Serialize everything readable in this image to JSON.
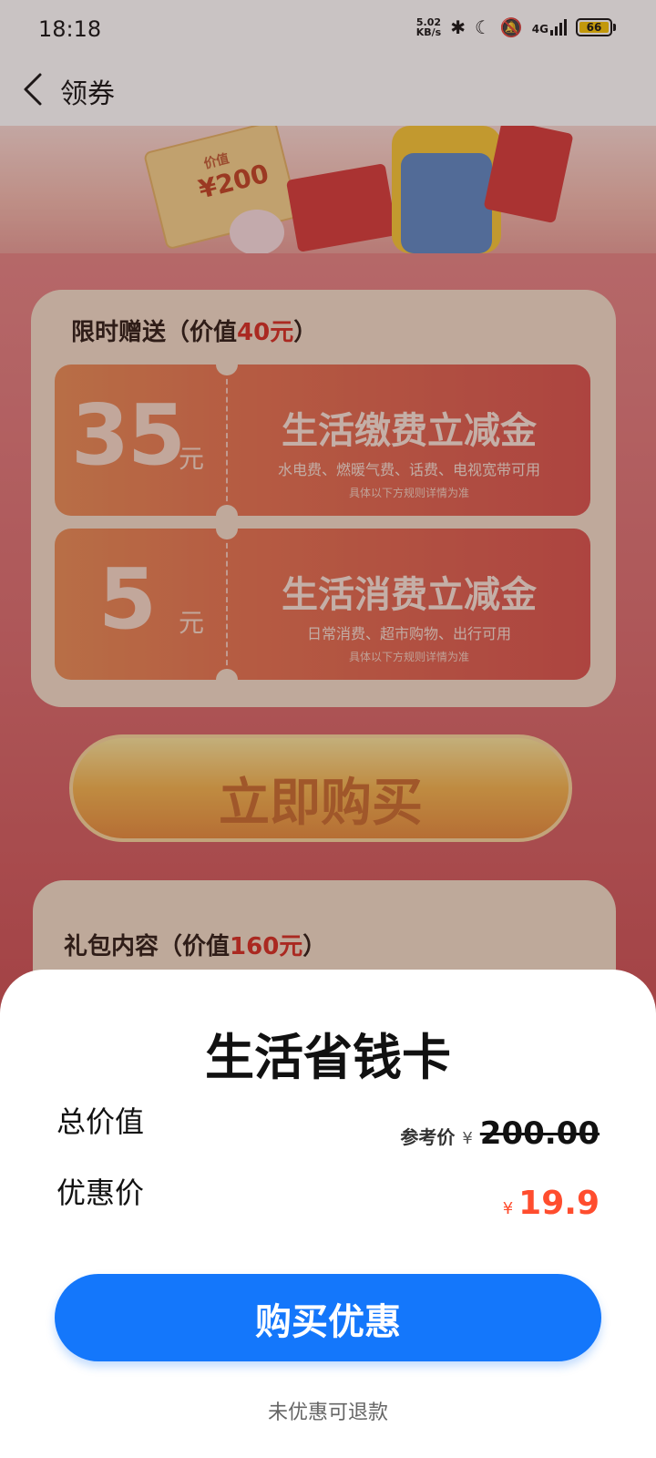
{
  "status_bar": {
    "time": "18:18",
    "net_speed_value": "5.02",
    "net_speed_unit": "KB/s",
    "network_type": "4G",
    "battery": "66"
  },
  "nav": {
    "title": "领券"
  },
  "hero": {
    "ticket_label": "价值",
    "ticket_value": "¥200"
  },
  "gift_card": {
    "title_prefix": "限时赠送（价值",
    "title_highlight": "40元",
    "title_suffix": "）",
    "coupons": [
      {
        "amount": "35",
        "unit": "元",
        "name": "生活缴费立减金",
        "desc": "水电费、燃暖气费、话费、电视宽带可用",
        "rule": "具体以下方规则详情为准"
      },
      {
        "amount": "5",
        "unit": "元",
        "name": "生活消费立减金",
        "desc": "日常消费、超市购物、出行可用",
        "rule": "具体以下方规则详情为准"
      }
    ]
  },
  "buy_now_label": "立即购买",
  "package_card": {
    "title_prefix": "礼包内容（价值",
    "title_highlight": "160元",
    "title_suffix": "）"
  },
  "sheet": {
    "title": "生活省钱卡",
    "total_label": "总价值",
    "ref_label": "参考价",
    "ref_currency": "¥",
    "ref_price": "200.00",
    "discount_label": "优惠价",
    "price_currency": "¥",
    "price": "19.9",
    "button_label": "购买优惠",
    "refund_note": "未优惠可退款"
  },
  "colors": {
    "primary_button": "#1477fb",
    "price_accent": "#ff4d2e",
    "highlight_red": "#d42a1f"
  }
}
